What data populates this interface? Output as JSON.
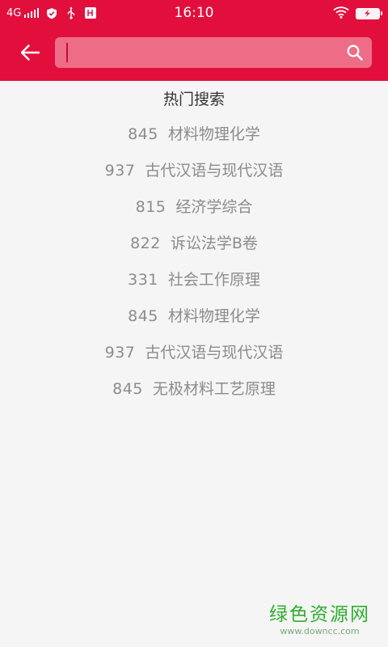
{
  "status_bar": {
    "network": "4G",
    "time": "16:10",
    "icons": [
      "signal-bars-icon",
      "shield-icon",
      "usb-icon",
      "debug-icon",
      "wifi-icon",
      "battery-charging-icon"
    ]
  },
  "header": {
    "back_icon": "arrow-left-icon",
    "search": {
      "value": "",
      "placeholder": "",
      "icon": "search-icon"
    }
  },
  "hot_search": {
    "title": "热门搜索",
    "items": [
      {
        "code": "845",
        "name": "材料物理化学"
      },
      {
        "code": "937",
        "name": "古代汉语与现代汉语"
      },
      {
        "code": "815",
        "name": "经济学综合"
      },
      {
        "code": "822",
        "name": "诉讼法学B卷"
      },
      {
        "code": "331",
        "name": "社会工作原理"
      },
      {
        "code": "845",
        "name": "材料物理化学"
      },
      {
        "code": "937",
        "name": "古代汉语与现代汉语"
      },
      {
        "code": "845",
        "name": "无极材料工艺原理"
      }
    ]
  },
  "watermark": {
    "main": "绿色资源网",
    "sub": "www.downcc.com"
  },
  "colors": {
    "header": "#e20f3c",
    "search_box": "#ee6d86",
    "background": "#f5f5f5",
    "title_text": "#333333",
    "item_text": "#8c8c8c",
    "watermark": "#2fae2f"
  }
}
